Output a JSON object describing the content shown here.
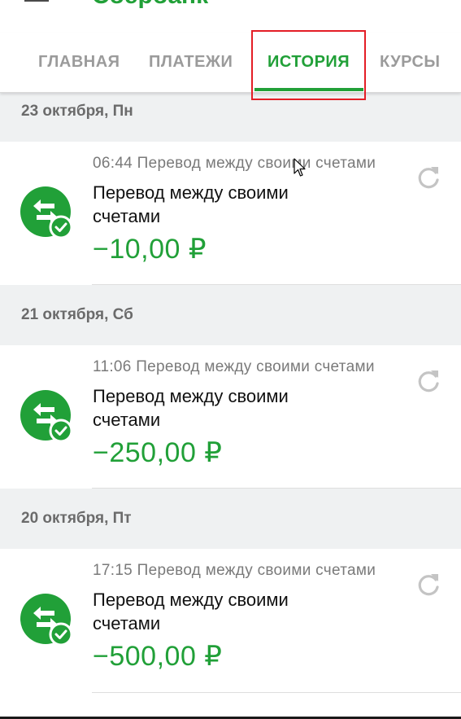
{
  "app": {
    "title": "Сбербанк"
  },
  "tabs": [
    {
      "label": "ГЛАВНАЯ",
      "active": false
    },
    {
      "label": "ПЛАТЕЖИ",
      "active": false
    },
    {
      "label": "ИСТОРИЯ",
      "active": true
    },
    {
      "label": "КУРСЫ",
      "active": false
    }
  ],
  "history": [
    {
      "date": "23 октября, Пн",
      "items": [
        {
          "meta": "06:44 Перевод между своими счетами",
          "title": "Перевод между своими счетами",
          "amount": "−10,00 ₽",
          "icon": "transfer-icon",
          "action_icon": "repeat-icon"
        }
      ]
    },
    {
      "date": "21 октября, Сб",
      "items": [
        {
          "meta": "11:06 Перевод между своими счетами",
          "title": "Перевод между своими счетами",
          "amount": "−250,00 ₽",
          "icon": "transfer-icon",
          "action_icon": "repeat-icon"
        }
      ]
    },
    {
      "date": "20 октября, Пт",
      "items": [
        {
          "meta": "17:15 Перевод между своими счетами",
          "title": "Перевод между своими счетами",
          "amount": "−500,00 ₽",
          "icon": "transfer-icon",
          "action_icon": "repeat-icon"
        }
      ]
    }
  ],
  "colors": {
    "brand_green": "#21a038",
    "tab_inactive": "#9b9b9b",
    "day_header_bg": "#eff1f2",
    "highlight_red": "#e41e26",
    "meta_text": "#7a7a7a"
  }
}
